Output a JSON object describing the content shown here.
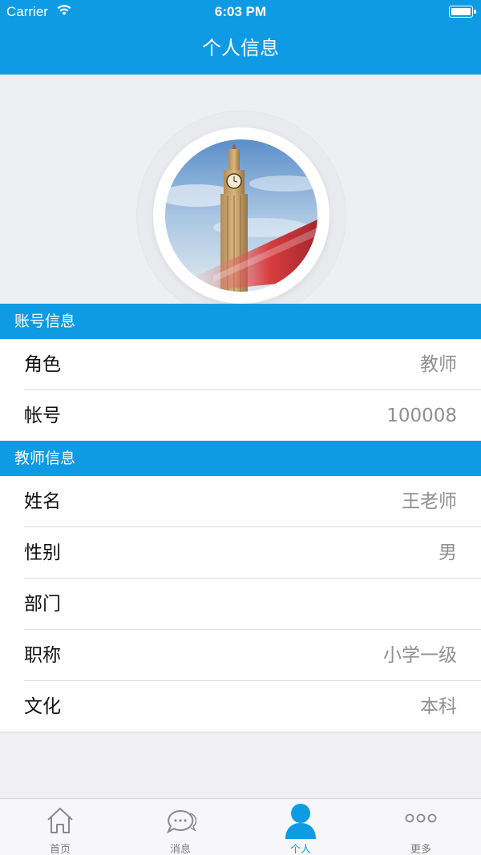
{
  "status_bar": {
    "carrier": "Carrier",
    "time": "6:03 PM"
  },
  "nav": {
    "title": "个人信息"
  },
  "sections": [
    {
      "title": "账号信息",
      "rows": [
        {
          "label": "角色",
          "value": "教师"
        },
        {
          "label": "帐号",
          "value": "100008"
        }
      ]
    },
    {
      "title": "教师信息",
      "rows": [
        {
          "label": "姓名",
          "value": "王老师"
        },
        {
          "label": "性别",
          "value": "男"
        },
        {
          "label": "部门",
          "value": ""
        },
        {
          "label": "职称",
          "value": "小学一级"
        },
        {
          "label": "文化",
          "value": "本科"
        }
      ]
    }
  ],
  "tabbar": {
    "items": [
      {
        "label": "首页",
        "icon": "home-icon"
      },
      {
        "label": "消息",
        "icon": "chat-bubbles-icon"
      },
      {
        "label": "个人",
        "icon": "person-icon",
        "active": true
      },
      {
        "label": "更多",
        "icon": "more-dots-icon"
      }
    ]
  },
  "colors": {
    "accent": "#0f9be4",
    "background": "#efeff4",
    "value_text": "#8f8f94"
  }
}
